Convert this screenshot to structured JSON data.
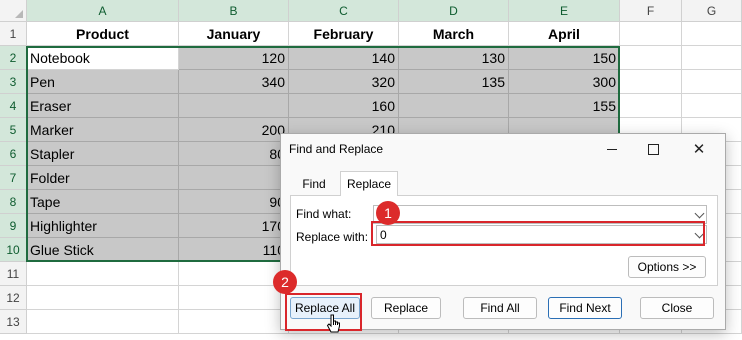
{
  "sheet": {
    "column_headers": [
      "A",
      "B",
      "C",
      "D",
      "E",
      "F",
      "G"
    ],
    "row_headers": [
      "1",
      "2",
      "3",
      "4",
      "5",
      "6",
      "7",
      "8",
      "9",
      "10",
      "11",
      "12",
      "13"
    ],
    "table_headers": [
      "Product",
      "January",
      "February",
      "March",
      "April"
    ],
    "rows": [
      [
        "Notebook",
        "120",
        "140",
        "130",
        "150"
      ],
      [
        "Pen",
        "340",
        "320",
        "135",
        "300"
      ],
      [
        "Eraser",
        "",
        "160",
        "",
        "155"
      ],
      [
        "Marker",
        "200",
        "210",
        "",
        ""
      ],
      [
        "Stapler",
        "80",
        "",
        "",
        ""
      ],
      [
        "Folder",
        "",
        "",
        "",
        ""
      ],
      [
        "Tape",
        "90",
        "",
        "",
        ""
      ],
      [
        "Highlighter",
        "170",
        "",
        "",
        ""
      ],
      [
        "Glue Stick",
        "110",
        "",
        "",
        ""
      ]
    ]
  },
  "dialog": {
    "title": "Find and Replace",
    "tabs": [
      "Find",
      "Replace"
    ],
    "find_label": "Find what:",
    "find_value": "",
    "replace_label": "Replace with:",
    "replace_value": "0",
    "options_label": "Options >>",
    "buttons": {
      "replace_all": "Replace All",
      "replace": "Replace",
      "find_all": "Find All",
      "find_next": "Find Next",
      "close": "Close"
    }
  },
  "markers": [
    "1",
    "2"
  ],
  "colors": {
    "marker_red": "#dc2b2b",
    "selection_green": "#1f6b3f",
    "selected_fill": "#c8c8c8"
  },
  "icons": [
    "minimize-icon",
    "maximize-icon",
    "close-icon",
    "cursor-icon",
    "chevron-down-icon"
  ]
}
